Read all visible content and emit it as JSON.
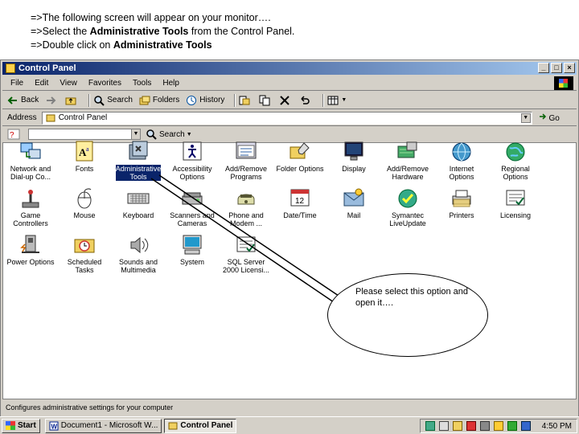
{
  "intro": {
    "line1": "=>The following screen will appear on your monitor….",
    "line2_pre": "=>Select the ",
    "line2_bold": "Administrative Tools",
    "line2_post": " from the Control Panel.",
    "line3_pre": "=>Double click on ",
    "line3_bold": "Administrative Tools"
  },
  "window": {
    "title": "Control Panel",
    "minimize": "_",
    "maximize": "□",
    "close": "×"
  },
  "menu": [
    "File",
    "Edit",
    "View",
    "Favorites",
    "Tools",
    "Help"
  ],
  "toolbar": {
    "back": "Back",
    "search": "Search",
    "folders": "Folders",
    "history": "History"
  },
  "address": {
    "label": "Address",
    "value": "Control Panel",
    "go": "Go"
  },
  "searchbar": {
    "label": "Search"
  },
  "icons": [
    {
      "label": "Network and\nDial-up Co...",
      "icon": "network-icon"
    },
    {
      "label": "Fonts",
      "icon": "fonts-icon"
    },
    {
      "label": "Administrative\nTools",
      "icon": "admin-tools-icon"
    },
    {
      "label": "Accessibility\nOptions",
      "icon": "accessibility-icon"
    },
    {
      "label": "Add/Remove\nPrograms",
      "icon": "add-remove-programs-icon"
    },
    {
      "label": "Folder Options",
      "icon": "folder-options-icon"
    },
    {
      "label": "Display",
      "icon": "display-icon"
    },
    {
      "label": "Add/Remove\nHardware",
      "icon": "add-remove-hardware-icon"
    },
    {
      "label": "Internet\nOptions",
      "icon": "internet-options-icon"
    },
    {
      "label": "Regional\nOptions",
      "icon": "regional-options-icon"
    },
    {
      "label": "Game\nControllers",
      "icon": "game-controllers-icon"
    },
    {
      "label": "Mouse",
      "icon": "mouse-icon"
    },
    {
      "label": "Keyboard",
      "icon": "keyboard-icon"
    },
    {
      "label": "Scanners and\nCameras",
      "icon": "scanners-icon"
    },
    {
      "label": "Phone and\nModem ...",
      "icon": "phone-modem-icon"
    },
    {
      "label": "Date/Time",
      "icon": "date-time-icon"
    },
    {
      "label": "Mail",
      "icon": "mail-icon"
    },
    {
      "label": "Symantec\nLiveUpdate",
      "icon": "symantec-icon"
    },
    {
      "label": "Printers",
      "icon": "printers-icon"
    },
    {
      "label": "Licensing",
      "icon": "licensing-icon"
    },
    {
      "label": "Power Options",
      "icon": "power-options-icon"
    },
    {
      "label": "Scheduled\nTasks",
      "icon": "scheduled-tasks-icon"
    },
    {
      "label": "Sounds and\nMultimedia",
      "icon": "sounds-icon"
    },
    {
      "label": "System",
      "icon": "system-icon"
    },
    {
      "label": "SQL Server\n2000 Licensi...",
      "icon": "sql-server-icon"
    }
  ],
  "status": "Configures administrative settings for your computer",
  "callout": "Please select this option and open it….",
  "taskbar": {
    "start": "Start",
    "tasks": [
      "Document1 - Microsoft W...",
      "Control Panel"
    ],
    "clock": "4:50 PM"
  },
  "colors": {
    "titlebar": "#0a246a",
    "selection": "#0a246a",
    "chrome": "#d4d0c8"
  }
}
